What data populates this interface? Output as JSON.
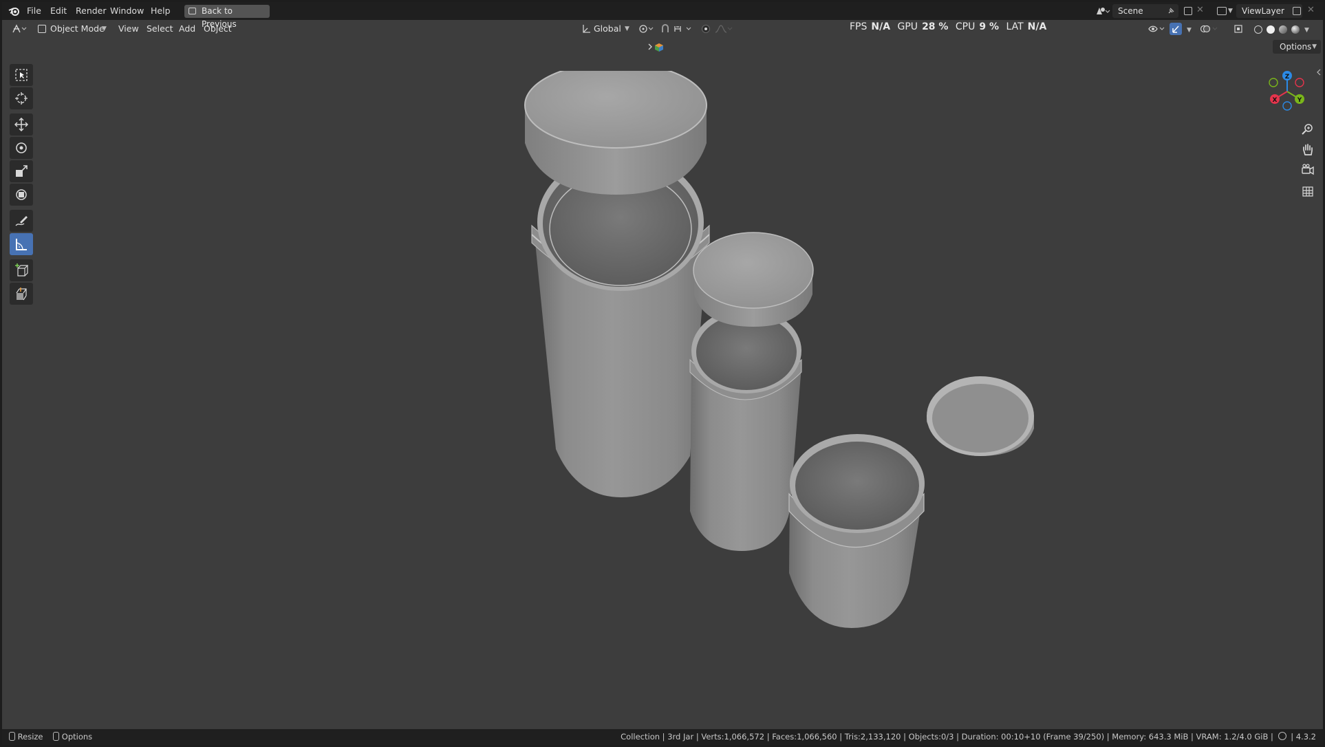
{
  "menu": {
    "items": [
      "File",
      "Edit",
      "Render",
      "Window",
      "Help"
    ],
    "back_button": "Back to Previous"
  },
  "scene_field": "Scene",
  "viewlayer_field": "ViewLayer",
  "viewport_header": {
    "mode": "Object Mode",
    "menus": [
      "View",
      "Select",
      "Add",
      "Object"
    ],
    "transform_orientation": "Global",
    "options": "Options"
  },
  "hud": {
    "fps_label": "FPS",
    "fps_value": "N/A",
    "gpu_label": "GPU",
    "gpu_value": "28 %",
    "cpu_label": "CPU",
    "cpu_value": "9 %",
    "lat_label": "LAT",
    "lat_value": "N/A"
  },
  "gizmo": {
    "z": "Z",
    "y": "Y",
    "x": "X",
    "colors": {
      "x": "#e5344c",
      "y": "#7ab61a",
      "z": "#2b8ae6"
    }
  },
  "tools": [
    "select-box",
    "cursor",
    "move",
    "rotate",
    "scale",
    "transform",
    "annotate",
    "measure",
    "add-cube",
    "extrude"
  ],
  "status": {
    "left": [
      "Resize",
      "Options"
    ],
    "right": "Collection | 3rd Jar | Verts:1,066,572 | Faces:1,066,560 | Tris:2,133,120 | Objects:0/3 | Duration: 00:10+10 (Frame 39/250) | Memory: 643.3 MiB | VRAM: 1.2/4.0 GiB |",
    "version": "4.3.2"
  },
  "colors": {
    "viewport_bg": "#3d3d3d",
    "accent": "#4772b3",
    "topbar": "#1f1f1f"
  }
}
